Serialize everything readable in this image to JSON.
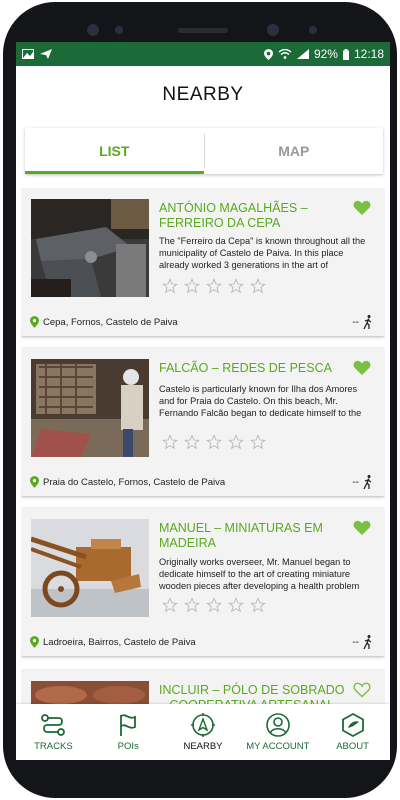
{
  "status_bar": {
    "battery": "92%",
    "time": "12:18"
  },
  "header": {
    "title": "NEARBY"
  },
  "tabs": [
    {
      "label": "LIST",
      "active": true
    },
    {
      "label": "MAP",
      "active": false
    }
  ],
  "colors": {
    "accent": "#5aa91e",
    "status_bar": "#1b6a37",
    "nav_text": "#1b6a37"
  },
  "cards": [
    {
      "title": "ANTÓNIO MAGALHÃES – FERREIRO DA CEPA",
      "description": "The \"Ferreiro da Cepa\" is known throughout all the municipality of Castelo de Paiva. In this place already worked 3 generations in the art of",
      "location": "Cepa, Fornos, Castelo de Paiva",
      "distance": "--",
      "favorite": true,
      "rating": 0
    },
    {
      "title": "FALCÃO – REDES DE PESCA",
      "description": "Castelo is particularly known for Ilha dos Amores and for Praia do Castelo. On this beach, Mr. Fernando Falcão began to dedicate himself to the",
      "location": "Praia do Castelo, Fornos, Castelo de Paiva",
      "distance": "--",
      "favorite": true,
      "rating": 0
    },
    {
      "title": "MANUEL – MINIATURAS EM MADEIRA",
      "description": "Originally works overseer, Mr. Manuel began to dedicate himself to the art of creating miniature wooden pieces after developing a health problem",
      "location": "Ladroeira, Bairros, Castelo de Paiva",
      "distance": "--",
      "favorite": true,
      "rating": 0
    },
    {
      "title": "INCLUIR – PÓLO DE SOBRADO – COOPERATIVA ARTESANAL –",
      "favorite": false
    }
  ],
  "bottom_nav": [
    {
      "label": "TRACKS",
      "icon": "route-icon"
    },
    {
      "label": "POIs",
      "icon": "flag-icon"
    },
    {
      "label": "NEARBY",
      "icon": "compass-icon",
      "active": true
    },
    {
      "label": "MY ACCOUNT",
      "icon": "user-icon"
    },
    {
      "label": "ABOUT",
      "icon": "hexagon-icon"
    }
  ]
}
